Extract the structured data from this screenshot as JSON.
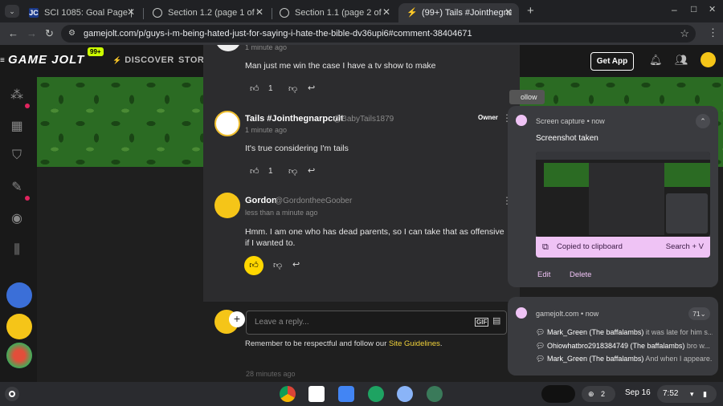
{
  "tabs": [
    {
      "title": "SCI 1085: Goal Page | acecon",
      "favicon": "JC"
    },
    {
      "title": "Section 1.2 (page 1 of 5) | ace",
      "favicon": ""
    },
    {
      "title": "Section 1.1 (page 2 of 3) | ace",
      "favicon": ""
    },
    {
      "title": "(99+) Tails #Jointhegnarpcult",
      "favicon": "GJ"
    }
  ],
  "new_tab_label": "+",
  "window_controls": {
    "minimize": "–",
    "maximize": "□",
    "close": "✕"
  },
  "address": "gamejolt.com/p/guys-i-m-being-hated-just-for-saying-i-hate-the-bible-dv36upi6#comment-38404671",
  "site": {
    "logo": "GAME JOLT",
    "logo_badge": "99+",
    "nav": [
      "DISCOVER",
      "STORE"
    ],
    "get_app": "Get App",
    "follow_partial": "ollow"
  },
  "comments": [
    {
      "time": "1 minute ago",
      "body": "Man just me win the case I have a tv show to make",
      "likes": "1"
    },
    {
      "name": "Tails #Jointhegnarpcult",
      "handle": "@BabyTails1879",
      "badge": "Owner",
      "time": "1 minute ago",
      "body": "It's true considering I'm tails",
      "likes": "1"
    },
    {
      "name": "Gordon",
      "handle": "@GordontheeGoober",
      "time": "less than a minute ago",
      "body": "Hmm. I am one who has dead parents, so I can take that as offensive if I wanted to."
    }
  ],
  "reply": {
    "placeholder": "Leave a reply...",
    "guidelines_prefix": "Remember to be respectful and follow our ",
    "guidelines_link": "Site Guidelines",
    "guidelines_suffix": "."
  },
  "obscured_time": "28 minutes ago",
  "screen_capture": {
    "app": "Screen capture",
    "dot": "•",
    "time": "now",
    "title": "Screenshot taken",
    "copied": "Copied to clipboard",
    "search": "Search + V",
    "edit": "Edit",
    "delete": "Delete"
  },
  "site_notif": {
    "source": "gamejolt.com",
    "dot": "•",
    "time": "now",
    "count": "71",
    "lines": [
      {
        "user": "Mark_Green (The baffalambs)",
        "text": "it was late for him s..."
      },
      {
        "user": "Ohiowhatbro2918384749 (The baffalambs)",
        "text": "bro w..."
      },
      {
        "user": "Mark_Green (The baffalambs)",
        "text": "And when I appeare..."
      }
    ]
  },
  "shelf": {
    "badge_count": "2",
    "date": "Sep 16",
    "time": "7:52"
  },
  "colors": {
    "accent_yellow": "#ffd700",
    "gamejolt_green": "#ccff00",
    "link_yellow": "#f2d33a",
    "capture_pink": "#efc3f5"
  }
}
